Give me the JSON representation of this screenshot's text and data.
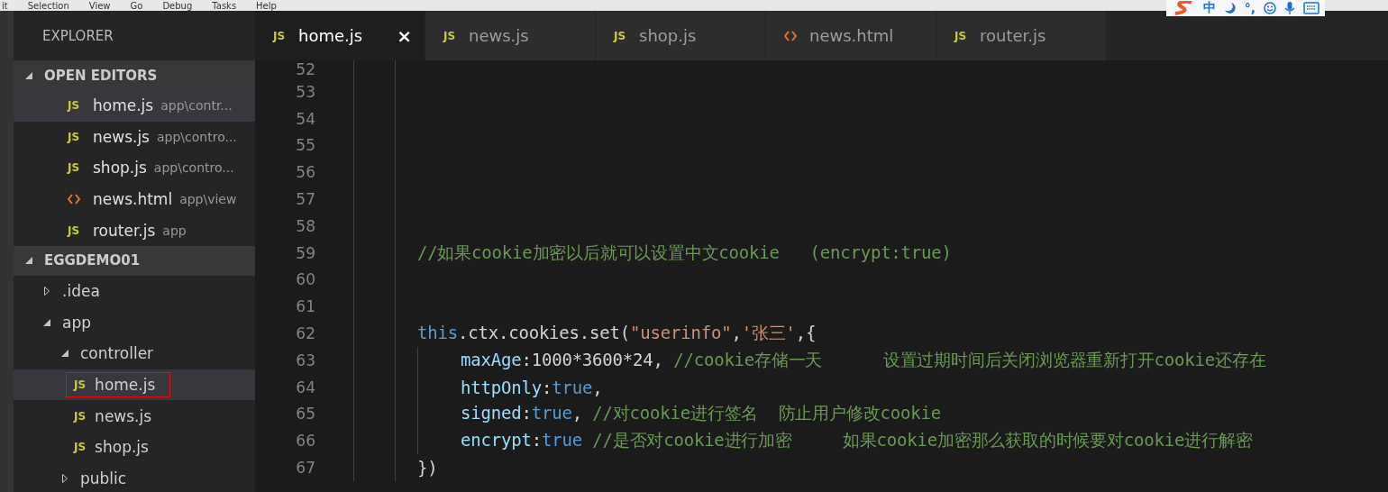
{
  "menu": [
    "it",
    "Selection",
    "View",
    "Go",
    "Debug",
    "Tasks",
    "Help"
  ],
  "ime": {
    "mode": "中",
    "punct": "°,"
  },
  "sidebar": {
    "title": "EXPLORER",
    "sections": [
      {
        "title": "OPEN EDITORS",
        "expanded": true,
        "kind": "editors",
        "items": [
          {
            "name": "home.js",
            "path": "app\\contr...",
            "kind": "js",
            "badge": "JS",
            "selected": true
          },
          {
            "name": "news.js",
            "path": "app\\contro...",
            "kind": "js",
            "badge": "JS",
            "selected": false
          },
          {
            "name": "shop.js",
            "path": "app\\contro...",
            "kind": "js",
            "badge": "JS",
            "selected": false
          },
          {
            "name": "news.html",
            "path": "app\\view",
            "kind": "html",
            "selected": false
          },
          {
            "name": "router.js",
            "path": "app",
            "kind": "js",
            "badge": "JS",
            "selected": false
          }
        ]
      },
      {
        "title": "EGGDEMO01",
        "expanded": true,
        "kind": "tree",
        "items": [
          {
            "name": ".idea",
            "kind": "folder",
            "expanded": false,
            "selected": false
          },
          {
            "name": "app",
            "kind": "folder",
            "expanded": true,
            "selected": false,
            "children": [
              {
                "name": "controller",
                "kind": "folder",
                "expanded": true,
                "selected": false,
                "children": [
                  {
                    "name": "home.js",
                    "kind": "js",
                    "badge": "JS",
                    "selected": true,
                    "outlined": true
                  },
                  {
                    "name": "news.js",
                    "kind": "js",
                    "badge": "JS",
                    "selected": false,
                    "outlined": false
                  },
                  {
                    "name": "shop.js",
                    "kind": "js",
                    "badge": "JS",
                    "selected": false,
                    "outlined": false
                  }
                ]
              },
              {
                "name": "public",
                "kind": "folder",
                "expanded": false,
                "selected": false
              }
            ]
          }
        ]
      }
    ]
  },
  "tabs": [
    {
      "label": "home.js",
      "kind": "js",
      "badge": "JS",
      "selected": true,
      "close": "×"
    },
    {
      "label": "news.js",
      "kind": "js",
      "badge": "JS",
      "selected": false
    },
    {
      "label": "shop.js",
      "kind": "js",
      "badge": "JS",
      "selected": false
    },
    {
      "label": "news.html",
      "kind": "html",
      "selected": false
    },
    {
      "label": "router.js",
      "kind": "js",
      "badge": "JS",
      "selected": false
    }
  ],
  "code": [
    {
      "number": "52"
    },
    {
      "number": "53"
    },
    {
      "number": "54"
    },
    {
      "number": "55"
    },
    {
      "number": "56"
    },
    {
      "number": "57"
    },
    {
      "number": "58"
    },
    {
      "number": "59",
      "kind": "outer",
      "tokens": [
        {
          "t": "//如果cookie加密以后就可以设置中文cookie   (encrypt:true)",
          "kind": "comment"
        }
      ]
    },
    {
      "number": "60"
    },
    {
      "number": "61"
    },
    {
      "number": "62",
      "kind": "outer",
      "tokens": [
        {
          "t": "this",
          "kind": "keyword"
        },
        {
          "t": ".ctx.cookies.set(",
          "kind": "plain"
        },
        {
          "t": "\"userinfo\"",
          "kind": "string"
        },
        {
          "t": ",",
          "kind": "plain"
        },
        {
          "t": "'张三'",
          "kind": "string"
        },
        {
          "t": ",{",
          "kind": "plain"
        }
      ]
    },
    {
      "number": "63",
      "kind": "inner",
      "tokens": [
        {
          "t": "maxAge",
          "kind": "prop"
        },
        {
          "t": ":1000*3600*24,",
          "kind": "plain"
        },
        {
          "t": "//cookie存储一天      设置过期时间后关闭浏览器重新打开cookie还存在",
          "kind": "comment"
        }
      ]
    },
    {
      "number": "64",
      "kind": "inner",
      "tokens": [
        {
          "t": "httpOnly",
          "kind": "prop"
        },
        {
          "t": ":",
          "kind": "plain"
        },
        {
          "t": "true",
          "kind": "keyword"
        },
        {
          "t": ",",
          "kind": "plain"
        }
      ]
    },
    {
      "number": "65",
      "kind": "inner",
      "tokens": [
        {
          "t": "signed",
          "kind": "prop"
        },
        {
          "t": ":",
          "kind": "plain"
        },
        {
          "t": "true",
          "kind": "keyword"
        },
        {
          "t": ",",
          "kind": "plain"
        },
        {
          "t": "//对cookie进行签名  防止用户修改cookie",
          "kind": "comment"
        }
      ]
    },
    {
      "number": "66",
      "kind": "inner",
      "tokens": [
        {
          "t": "encrypt",
          "kind": "prop"
        },
        {
          "t": ":",
          "kind": "plain"
        },
        {
          "t": "true",
          "kind": "keyword"
        },
        {
          "t": "//是否对cookie进行加密     如果cookie加密那么获取的时候要对cookie进行解密",
          "kind": "comment"
        }
      ]
    },
    {
      "number": "67",
      "kind": "outer",
      "tokens": [
        {
          "t": "})",
          "kind": "plain"
        }
      ]
    }
  ]
}
